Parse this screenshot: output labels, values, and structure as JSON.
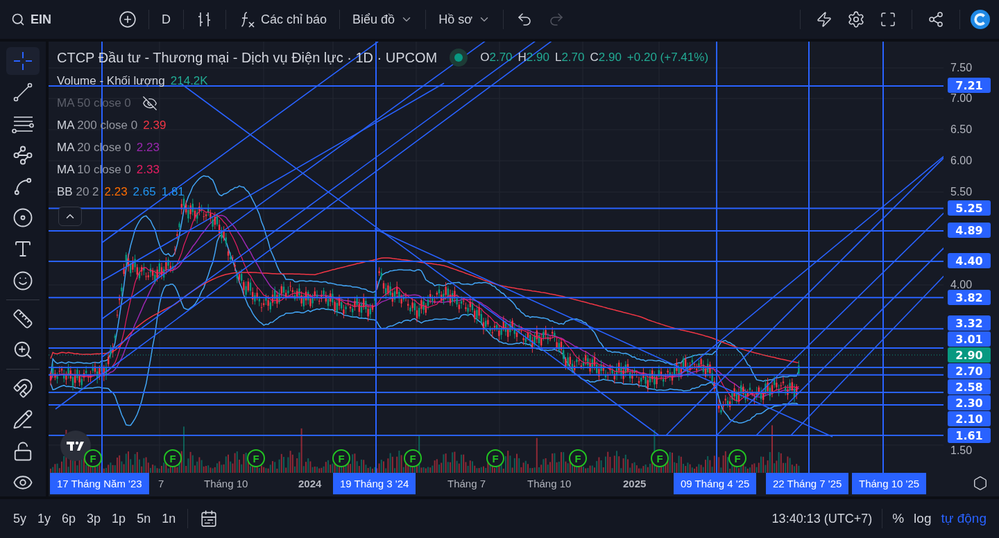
{
  "toolbar": {
    "symbol": "EIN",
    "interval": "D",
    "indicators": "Các chỉ báo",
    "chart_menu": "Biểu đồ",
    "profile_menu": "Hồ sơ"
  },
  "tools": [
    {
      "kind": "crosshair",
      "selected": true
    },
    {
      "kind": "trendline",
      "selected": false
    },
    {
      "kind": "fib",
      "selected": false
    },
    {
      "kind": "pattern",
      "selected": false
    },
    {
      "kind": "projection",
      "selected": false
    },
    {
      "kind": "shape",
      "selected": false
    },
    {
      "kind": "text",
      "selected": false
    },
    {
      "kind": "emoji",
      "selected": false
    },
    {
      "kind": "ruler",
      "selected": false
    },
    {
      "kind": "zoom",
      "selected": false
    },
    {
      "kind": "magnet",
      "selected": false
    },
    {
      "kind": "lockdraw",
      "selected": false
    },
    {
      "kind": "lock",
      "selected": false
    },
    {
      "kind": "visibility",
      "selected": false
    }
  ],
  "legend": {
    "title": "CTCP Đầu tư - Thương mại - Dịch vụ Điện lực · 1D · UPCOM",
    "ohlc": [
      {
        "label": "O",
        "value": "2.70"
      },
      {
        "label": "H",
        "value": "2.90"
      },
      {
        "label": "L",
        "value": "2.70"
      },
      {
        "label": "C",
        "value": "2.90"
      }
    ],
    "change": "+0.20 (+7.41%)",
    "indicators": [
      {
        "name": "Volume - Khối lượng",
        "hidden": false,
        "values": [
          {
            "text": "214.2K",
            "color": "#22ab94"
          }
        ]
      },
      {
        "name": "MA",
        "params": "50 close 0",
        "hidden": true
      },
      {
        "name": "MA",
        "params": "200 close 0",
        "hidden": false,
        "values": [
          {
            "text": "2.39",
            "color": "#f23645"
          }
        ]
      },
      {
        "name": "MA",
        "params": "20 close 0",
        "hidden": false,
        "values": [
          {
            "text": "2.23",
            "color": "#9c27b0"
          }
        ]
      },
      {
        "name": "MA",
        "params": "10 close 0",
        "hidden": false,
        "values": [
          {
            "text": "2.33",
            "color": "#e91e63"
          }
        ]
      },
      {
        "name": "BB",
        "params": "20 2",
        "hidden": false,
        "values": [
          {
            "text": "2.23",
            "color": "#ff6d00"
          },
          {
            "text": "2.65",
            "color": "#2196f3"
          },
          {
            "text": "1.81",
            "color": "#2196f3"
          }
        ]
      }
    ]
  },
  "price_axis": {
    "ticks": [
      "7.50",
      "7.00",
      "6.50",
      "6.00",
      "5.50",
      "4.00",
      "1.50"
    ],
    "levels": [
      {
        "text": "7.21",
        "kind": "line"
      },
      {
        "text": "5.25",
        "kind": "line"
      },
      {
        "text": "4.89",
        "kind": "line"
      },
      {
        "text": "4.40",
        "kind": "line"
      },
      {
        "text": "3.82",
        "kind": "line"
      },
      {
        "text": "3.32",
        "kind": "line"
      },
      {
        "text": "3.01",
        "kind": "line"
      },
      {
        "text": "2.90",
        "kind": "last"
      },
      {
        "text": "2.70",
        "kind": "line"
      },
      {
        "text": "2.58",
        "kind": "line"
      },
      {
        "text": "2.30",
        "kind": "line"
      },
      {
        "text": "2.10",
        "kind": "line"
      },
      {
        "text": "1.61",
        "kind": "line"
      }
    ]
  },
  "events": [
    {
      "label": "F"
    },
    {
      "label": "F"
    },
    {
      "label": "F"
    },
    {
      "label": "F"
    },
    {
      "label": "F"
    },
    {
      "label": "F"
    },
    {
      "label": "F"
    },
    {
      "label": "F"
    },
    {
      "label": "F"
    }
  ],
  "time_axis": [
    {
      "text": "17 Tháng Năm '23",
      "kind": "marker"
    },
    {
      "text": "7",
      "kind": "tick"
    },
    {
      "text": "Tháng 10",
      "kind": "tick"
    },
    {
      "text": "2024",
      "kind": "year"
    },
    {
      "text": "19 Tháng 3 '24",
      "kind": "marker"
    },
    {
      "text": "Tháng 7",
      "kind": "tick"
    },
    {
      "text": "Tháng 10",
      "kind": "tick"
    },
    {
      "text": "2025",
      "kind": "year"
    },
    {
      "text": "09 Tháng 4 '25",
      "kind": "marker"
    },
    {
      "text": "22 Tháng 7 '25",
      "kind": "marker"
    },
    {
      "text": "Tháng 10 '25",
      "kind": "marker"
    }
  ],
  "range_buttons": [
    "5y",
    "1y",
    "6p",
    "3p",
    "1p",
    "5n",
    "1n"
  ],
  "clock": "13:40:13 (UTC+7)",
  "scale_options": [
    {
      "label": "%",
      "selected": false
    },
    {
      "label": "log",
      "selected": false
    },
    {
      "label": "tự động",
      "selected": true
    }
  ]
}
